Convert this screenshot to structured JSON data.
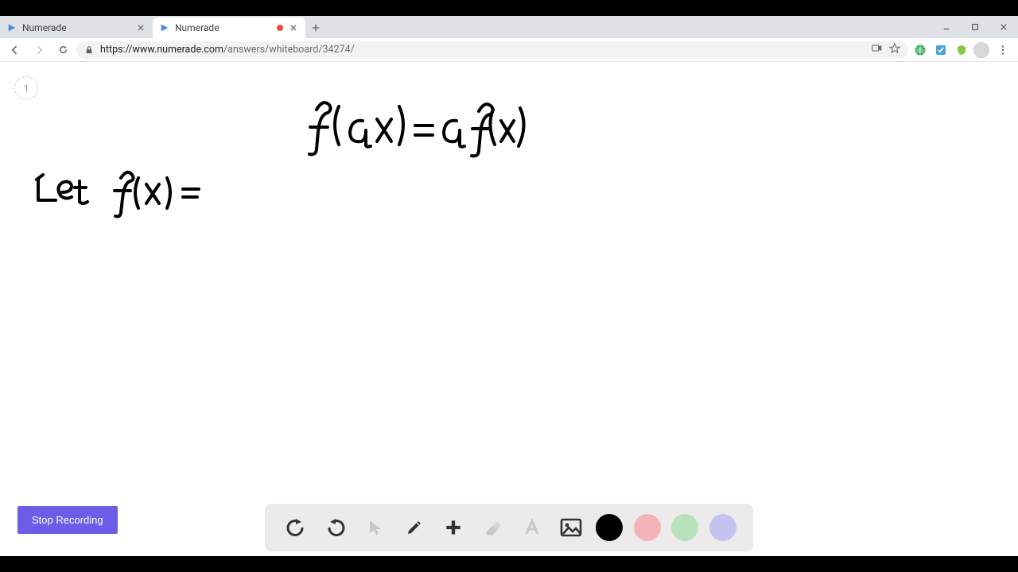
{
  "tabs": [
    {
      "title": "Numerade",
      "recording": false,
      "active": false
    },
    {
      "title": "Numerade",
      "recording": true,
      "active": true
    }
  ],
  "window_controls": {
    "minimize": "–",
    "maximize": "▢",
    "close": "✕"
  },
  "nav": {
    "back_label": "Back",
    "forward_label": "Forward",
    "reload_label": "Reload"
  },
  "address": {
    "host": "https://www.numerade.com",
    "path": "/answers/whiteboard/34274/"
  },
  "extensions": {
    "camera": "camera-icon",
    "star": "star-icon",
    "ext1": {
      "name": "globe-ext-icon",
      "color": "#2fa84f"
    },
    "ext2": {
      "name": "check-ext-icon",
      "color": "#4aa3df"
    },
    "ext3": {
      "name": "shield-ext-icon",
      "color": "#8ec63f"
    },
    "avatar": "user-avatar"
  },
  "page": {
    "indicator": "1",
    "stop_recording_label": "Stop Recording"
  },
  "toolbar": {
    "undo": "undo-icon",
    "redo": "redo-icon",
    "pointer": "pointer-icon",
    "pen": "pen-icon",
    "add": "add-icon",
    "eraser": "eraser-icon",
    "text": "text-icon",
    "image": "image-icon",
    "colors": [
      {
        "name": "color-black",
        "hex": "#000000"
      },
      {
        "name": "color-pink",
        "hex": "#f3b3b8"
      },
      {
        "name": "color-green",
        "hex": "#b7e2bb"
      },
      {
        "name": "color-purple",
        "hex": "#c4c2f1"
      }
    ]
  },
  "handwriting": {
    "line1": "f(ax) = a f(x)",
    "line2": "Let  f(x) ="
  }
}
